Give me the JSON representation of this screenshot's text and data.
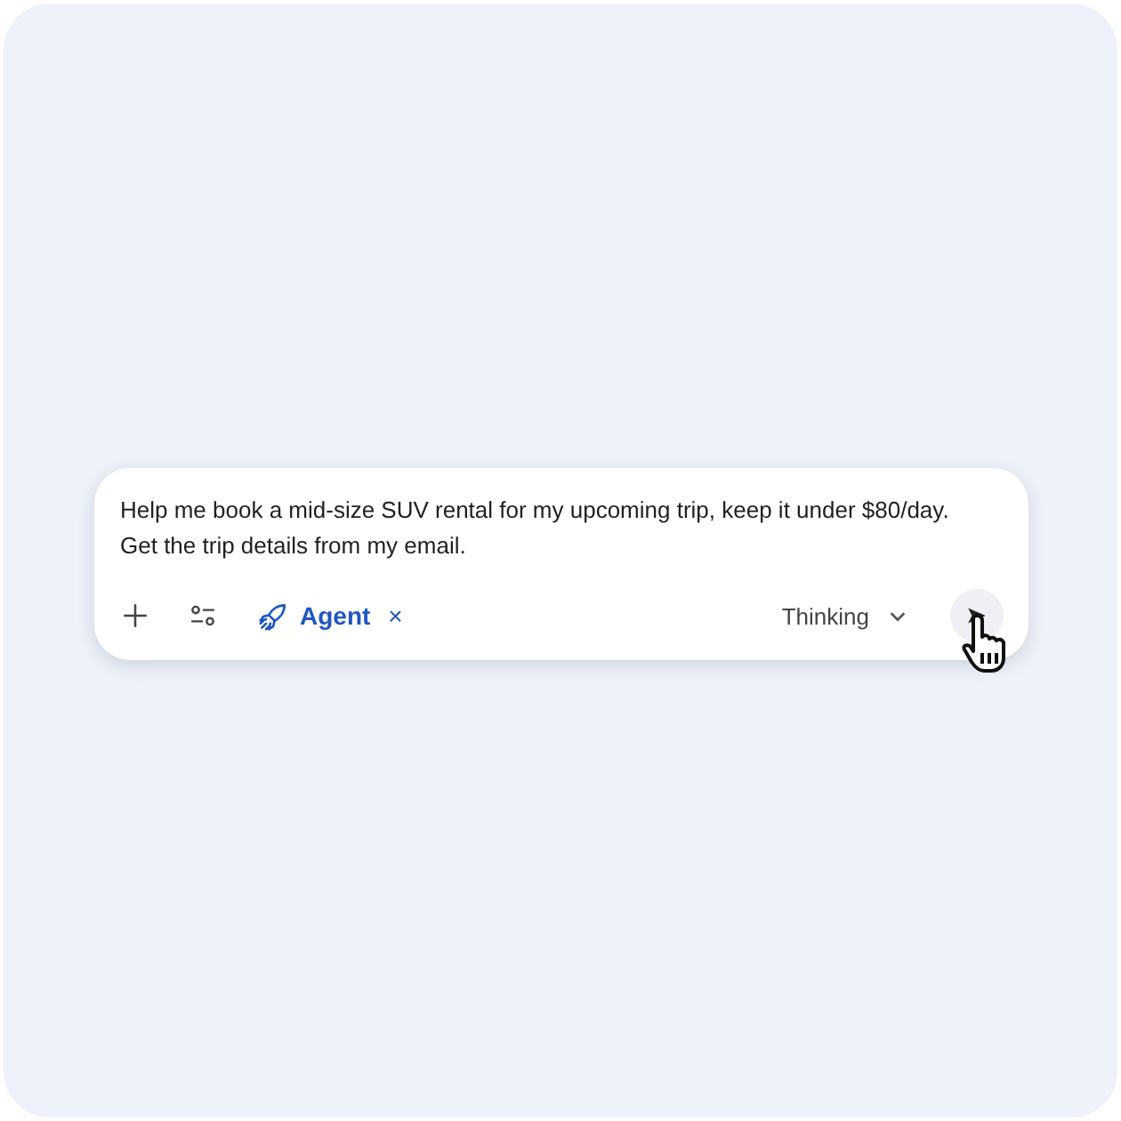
{
  "prompt": {
    "value": "Help me book a mid-size SUV rental for my upcoming trip, keep it under $80/day. Get the trip details from my email."
  },
  "tool_chip": {
    "label": "Agent",
    "close": "×"
  },
  "mode_selector": {
    "label": "Thinking"
  }
}
